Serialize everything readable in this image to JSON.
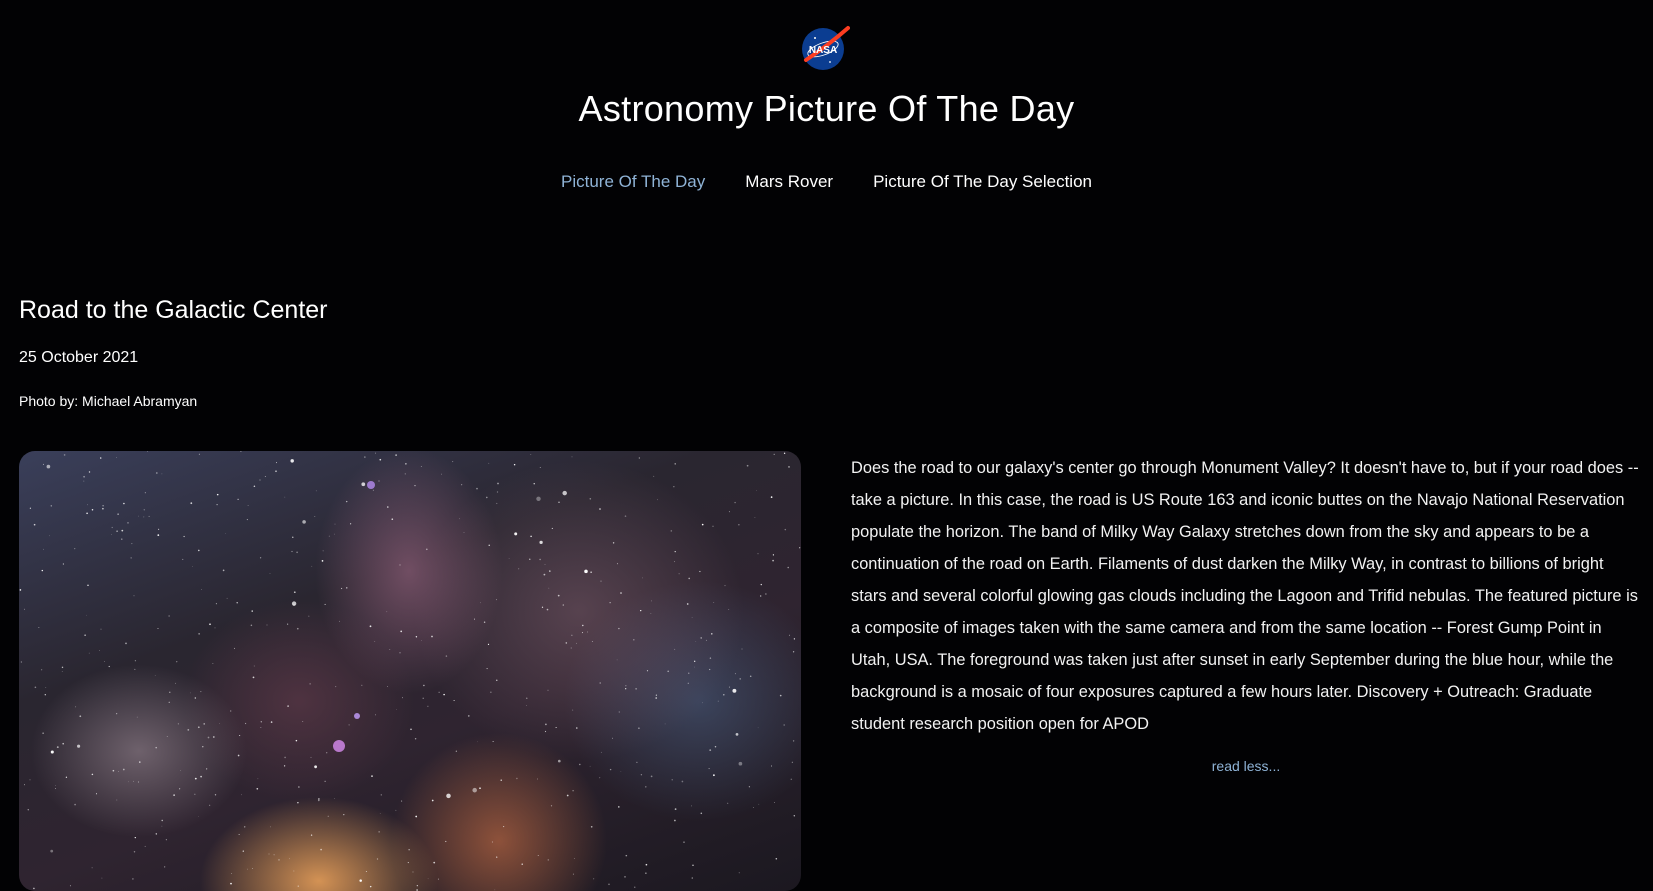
{
  "header": {
    "logo_text": "NASA",
    "title": "Astronomy Picture Of The Day"
  },
  "nav": {
    "items": [
      {
        "label": "Picture Of The Day",
        "active": true
      },
      {
        "label": "Mars Rover",
        "active": false
      },
      {
        "label": "Picture Of The Day Selection",
        "active": false
      }
    ]
  },
  "post": {
    "title": "Road to the Galactic Center",
    "date": "25 October 2021",
    "credit": "Photo by: Michael Abramyan",
    "image_icon": "milky-way-photo",
    "description": "Does the road to our galaxy's center go through Monument Valley? It doesn't have to, but if your road does -- take a picture. In this case, the road is US Route 163 and iconic buttes on the Navajo National Reservation populate the horizon. The band of Milky Way Galaxy stretches down from the sky and appears to be a continuation of the road on Earth. Filaments of dust darken the Milky Way, in contrast to billions of bright stars and several colorful glowing gas clouds including the Lagoon and Trifid nebulas. The featured picture is a composite of images taken with the same camera and from the same location -- Forest Gump Point in Utah, USA. The foreground was taken just after sunset in early September during the blue hour, while the background is a mosaic of four exposures captured a few hours later. Discovery + Outreach: Graduate student research position open for APOD",
    "toggle_label": "read less..."
  },
  "colors": {
    "background": "#020204",
    "accent": "#8fb3d6",
    "text": "#ffffff"
  }
}
